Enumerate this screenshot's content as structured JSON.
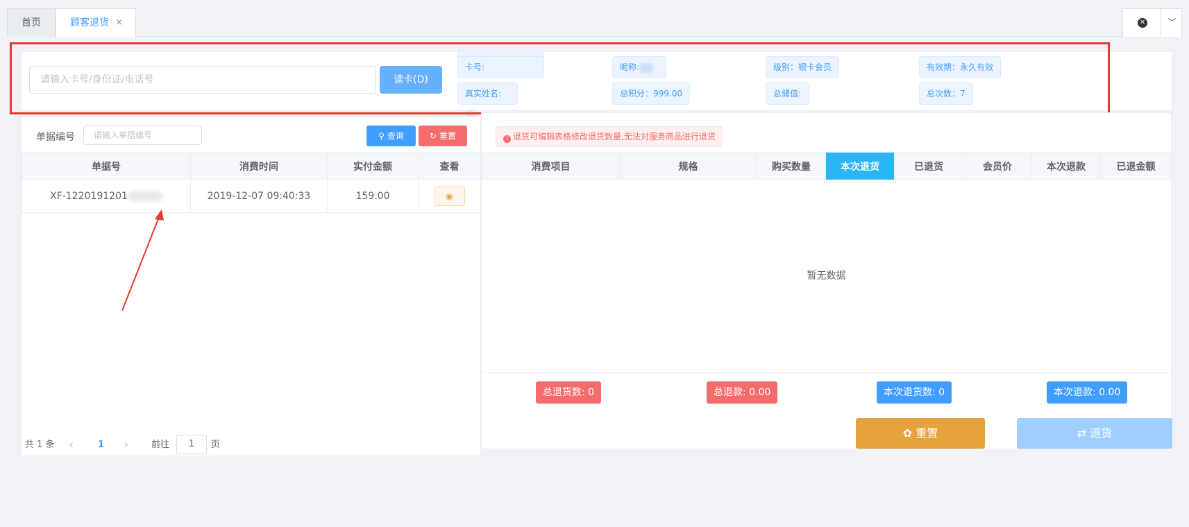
{
  "tabs": {
    "home": "首页",
    "active": "顾客退货",
    "close": "×"
  },
  "member": {
    "search_placeholder": "请输入卡号/身份证/电话号",
    "read_card": "读卡(D)",
    "card_no_label": "卡号:",
    "nickname_label": "昵称:",
    "level": "级别：银卡会员",
    "validity": "有效期：永久有效",
    "real_name_label": "真实姓名:",
    "total_points": "总积分：999.00",
    "total_stored": "总储值:",
    "total_times": "总次数：7"
  },
  "orders": {
    "label": "单据编号",
    "placeholder": "请输入单据编号",
    "query": "查询",
    "reset": "重置",
    "columns": [
      "单据号",
      "消费时间",
      "实付金额",
      "查看"
    ],
    "rows": [
      {
        "no": "XF-1220191201",
        "time": "2019-12-07 09:40:33",
        "amount": "159.00"
      }
    ],
    "pager": {
      "total": "共 1 条",
      "prev": "‹",
      "page": "1",
      "next": "›",
      "goto": "前往",
      "page_input": "1",
      "page_unit": "页"
    }
  },
  "returns": {
    "warning": "退货可编辑表格修改退货数量,无法对服务商品进行退货",
    "columns": [
      "消费项目",
      "规格",
      "购买数量",
      "本次退货",
      "已退货",
      "会员价",
      "本次退款",
      "已退金额"
    ],
    "empty": "暂无数据",
    "total_return_count": "总退货数: 0",
    "total_refund": "总退款: 0.00",
    "this_return_count": "本次退货数: 0",
    "this_refund": "本次退款: 0.00",
    "reset_button": "重置",
    "return_button": "退货"
  }
}
